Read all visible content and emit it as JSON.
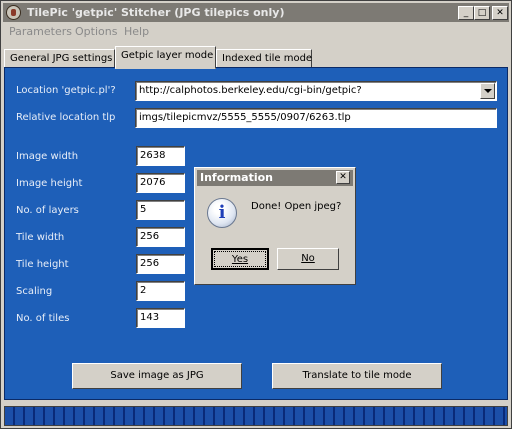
{
  "window": {
    "title": "TilePic 'getpic' Stitcher (JPG tilepics only)",
    "controls": {
      "minimize": "_",
      "maximize": "□",
      "close": "✕"
    }
  },
  "menu": [
    "Parameters",
    "Options",
    "Help"
  ],
  "tabs": [
    {
      "label": "General JPG settings",
      "active": false
    },
    {
      "label": "Getpic layer mode",
      "active": true
    },
    {
      "label": "Indexed tile mode",
      "active": false
    }
  ],
  "form": {
    "location_label": "Location 'getpic.pl'?",
    "location_value": "http://calphotos.berkeley.edu/cgi-bin/getpic?",
    "relative_label": "Relative location tlp",
    "relative_value": "imgs/tilepicmvz/5555_5555/0907/6263.tlp",
    "fields": [
      {
        "label": "Image width",
        "value": "2638"
      },
      {
        "label": "Image height",
        "value": "2076"
      },
      {
        "label": "No. of layers",
        "value": "5"
      },
      {
        "label": "Tile width",
        "value": "256"
      },
      {
        "label": "Tile height",
        "value": "256"
      },
      {
        "label": "Scaling",
        "value": "2"
      },
      {
        "label": "No. of tiles",
        "value": "143"
      }
    ]
  },
  "buttons": {
    "save": "Save image as JPG",
    "translate": "Translate to tile mode"
  },
  "progress": {
    "fraction": 1.0
  },
  "dialog": {
    "title": "Information",
    "close": "✕",
    "icon": "i",
    "message": "Done! Open jpeg?",
    "yes": "Yes",
    "no": "No"
  },
  "colors": {
    "panel_background": "#1e5fb8",
    "titlebar": "#7d7a74",
    "window_face": "#d4d0c8",
    "progress": "#1c4fa8"
  }
}
